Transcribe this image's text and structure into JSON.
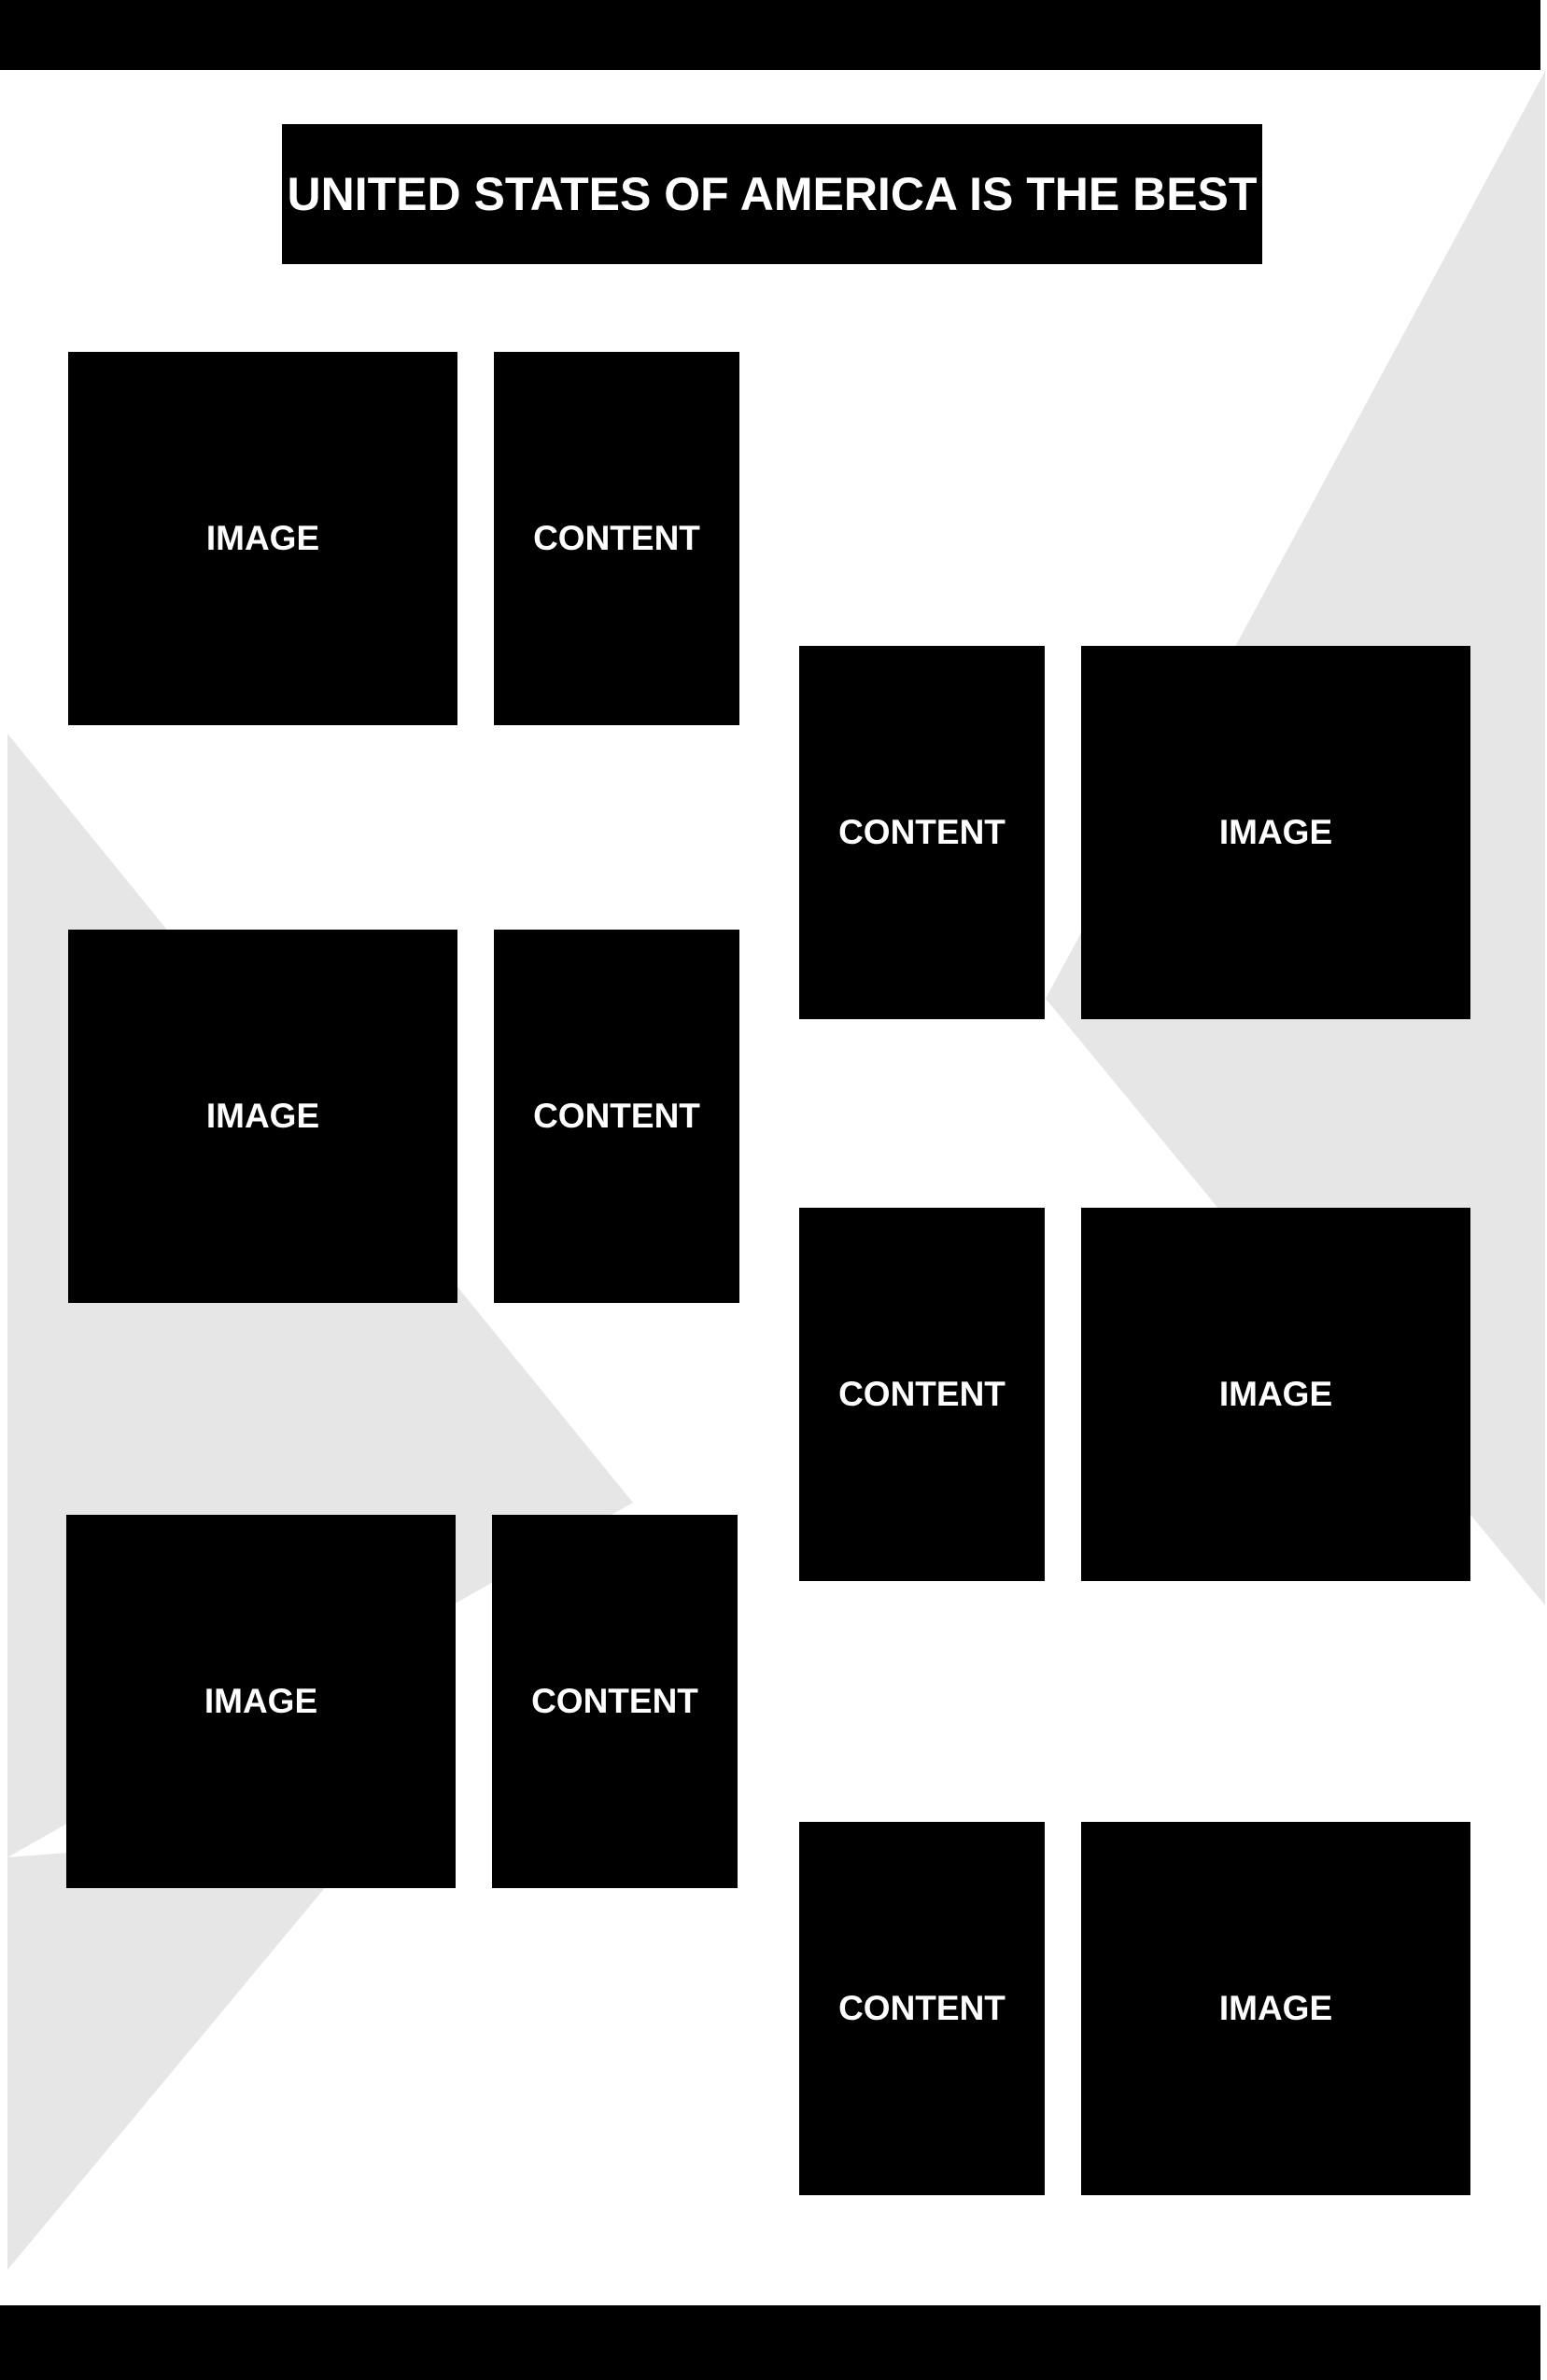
{
  "title": "UNITED STATES OF AMERICA IS THE BEST",
  "colors": {
    "background": "#ffffff",
    "blocks": "#000000",
    "text": "#ffffff",
    "decor": "#e6e6e6"
  },
  "left_rows": [
    {
      "image_label": "IMAGE",
      "content_label": "CONTENT"
    },
    {
      "image_label": "IMAGE",
      "content_label": "CONTENT"
    },
    {
      "image_label": "IMAGE",
      "content_label": "CONTENT"
    }
  ],
  "right_rows": [
    {
      "content_label": "CONTENT",
      "image_label": "IMAGE"
    },
    {
      "content_label": "CONTENT",
      "image_label": "IMAGE"
    },
    {
      "content_label": "CONTENT",
      "image_label": "IMAGE"
    }
  ]
}
